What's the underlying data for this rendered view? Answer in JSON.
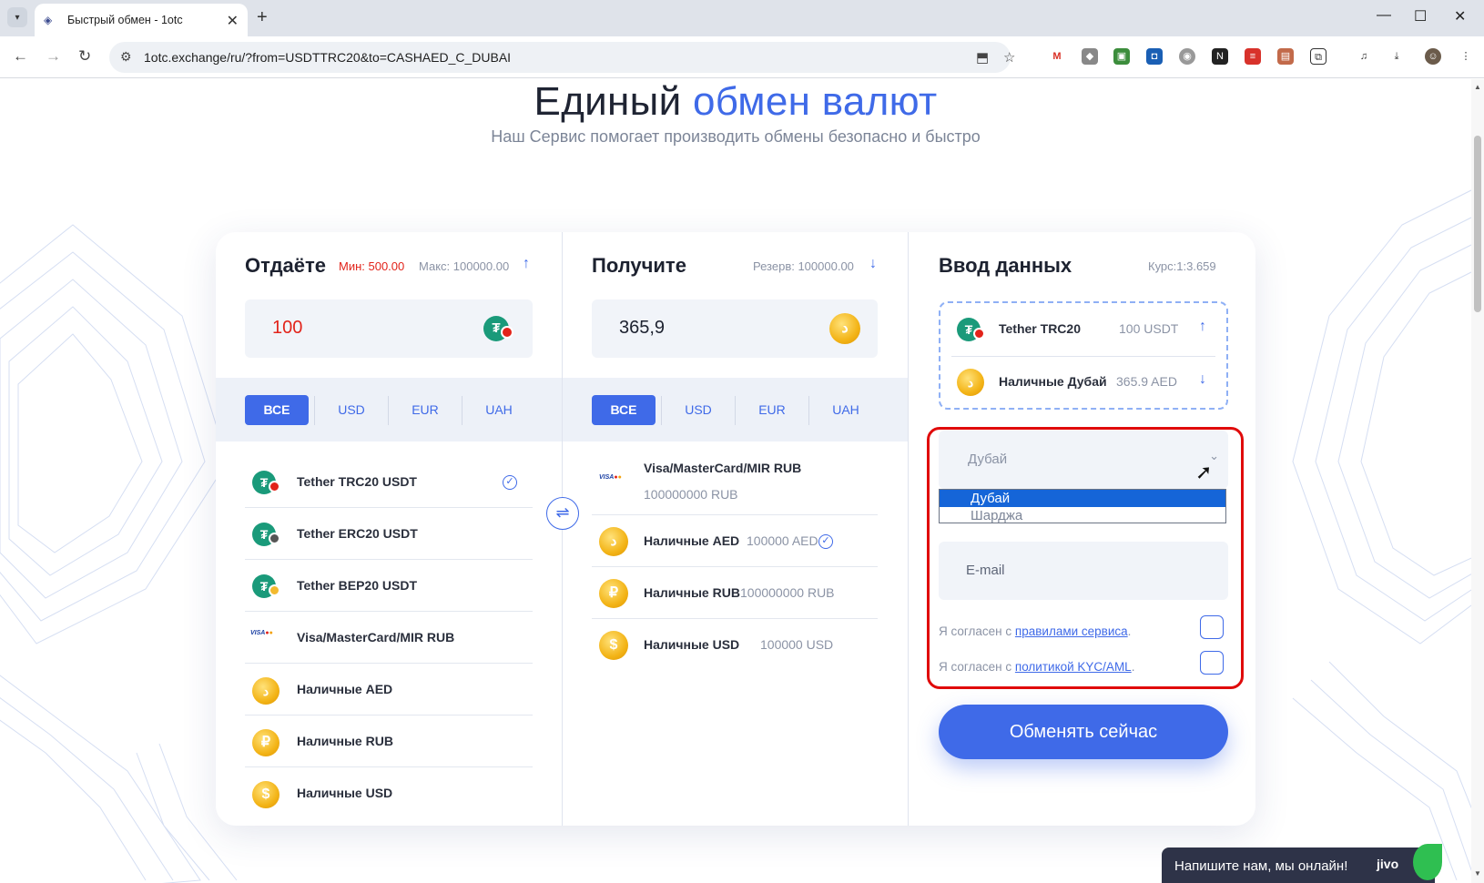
{
  "browser": {
    "tab_title": "Быстрый обмен - 1otc",
    "url": "1otc.exchange/ru/?from=USDTTRC20&to=CASHAED_C_DUBAI"
  },
  "hero": {
    "title_main": "Единый",
    "title_accent": "обмен валют",
    "subtitle": "Наш Сервис помогает производить обмены безопасно и быстро"
  },
  "give": {
    "title": "Отдаёте",
    "min_label": "Мин: 500.00",
    "max_label": "Макс: 100000.00",
    "amount": "100",
    "filters": [
      "ВСЕ",
      "USD",
      "EUR",
      "UAH"
    ],
    "items": [
      {
        "name": "Tether TRC20 USDT",
        "selected": true
      },
      {
        "name": "Tether ERC20 USDT",
        "selected": false
      },
      {
        "name": "Tether BEP20 USDT",
        "selected": false
      },
      {
        "name": "Visa/MasterCard/MIR RUB",
        "selected": false
      },
      {
        "name": "Наличные AED",
        "selected": false
      },
      {
        "name": "Наличные RUB",
        "selected": false
      },
      {
        "name": "Наличные USD",
        "selected": false
      }
    ]
  },
  "receive": {
    "title": "Получите",
    "reserve_label": "Резерв: 100000.00",
    "amount": "365,9",
    "filters": [
      "ВСЕ",
      "USD",
      "EUR",
      "UAH"
    ],
    "items": [
      {
        "name": "Visa/MasterCard/MIR RUB",
        "amount": "100000000 RUB",
        "selected": false
      },
      {
        "name": "Наличные AED",
        "amount": "100000 AED",
        "selected": true
      },
      {
        "name": "Наличные RUB",
        "amount": "100000000 RUB",
        "selected": false
      },
      {
        "name": "Наличные USD",
        "amount": "100000 USD",
        "selected": false
      }
    ]
  },
  "details": {
    "title": "Ввод данных",
    "rate": "Курс:1:3.659",
    "from_name": "Tether TRC20",
    "from_amount": "100 USDT",
    "to_name": "Наличные Дубай",
    "to_amount": "365.9 AED",
    "city_select_value": "Дубай",
    "city_options": [
      "Дубай",
      "Шарджа"
    ],
    "email_placeholder": "E-mail",
    "agree_prefix": "Я согласен с",
    "rules_link": "правилами сервиса",
    "kyc_link": "политикой KYC/AML",
    "submit_label": "Обменять сейчас"
  },
  "chat": {
    "text": "Напишите нам, мы онлайн!",
    "brand": "jivo"
  },
  "colors": {
    "accent": "#3f6ae8",
    "min_red": "#e2231a",
    "highlight_frame": "#e00b0b"
  }
}
